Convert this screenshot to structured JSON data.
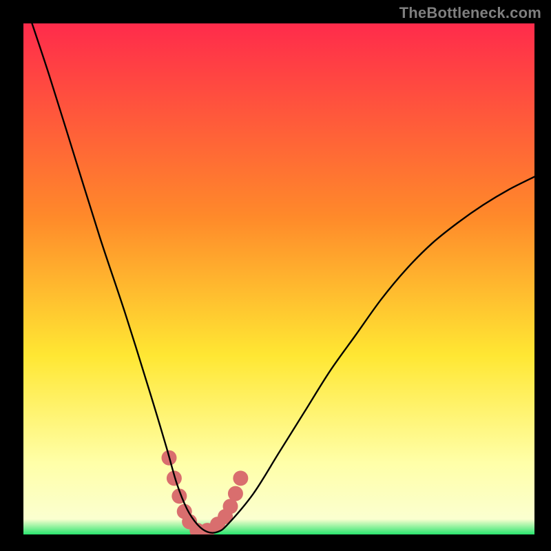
{
  "watermark": "TheBottleneck.com",
  "colors": {
    "frame": "#000000",
    "gradient_top": "#ff2b4b",
    "gradient_mid1": "#ff8a2a",
    "gradient_mid2": "#ffe733",
    "gradient_band": "#ffffa8",
    "gradient_bottom": "#29e56e",
    "curve": "#000000",
    "marker": "#d96e6e"
  },
  "chart_data": {
    "type": "line",
    "title": "",
    "xlabel": "",
    "ylabel": "",
    "xlim": [
      0,
      100
    ],
    "ylim": [
      0,
      100
    ],
    "series": [
      {
        "name": "bottleneck-curve",
        "x": [
          0,
          5,
          10,
          15,
          20,
          25,
          28,
          30,
          32,
          34,
          36,
          38,
          40,
          45,
          50,
          55,
          60,
          65,
          70,
          75,
          80,
          85,
          90,
          95,
          100
        ],
        "y": [
          105,
          90,
          74,
          58,
          43,
          27,
          17,
          10,
          5,
          2,
          0.5,
          0.5,
          2,
          8,
          16,
          24,
          32,
          39,
          46,
          52,
          57,
          61,
          64.5,
          67.5,
          70
        ]
      }
    ],
    "markers": {
      "name": "highlight-band",
      "x": [
        28.5,
        29.5,
        30.5,
        31.5,
        32.5,
        34,
        36,
        38,
        39.5,
        40.5,
        41.5,
        42.5
      ],
      "y": [
        15,
        11,
        7.5,
        4.5,
        2.5,
        0.8,
        0.8,
        2,
        3.5,
        5.5,
        8,
        11
      ]
    }
  }
}
